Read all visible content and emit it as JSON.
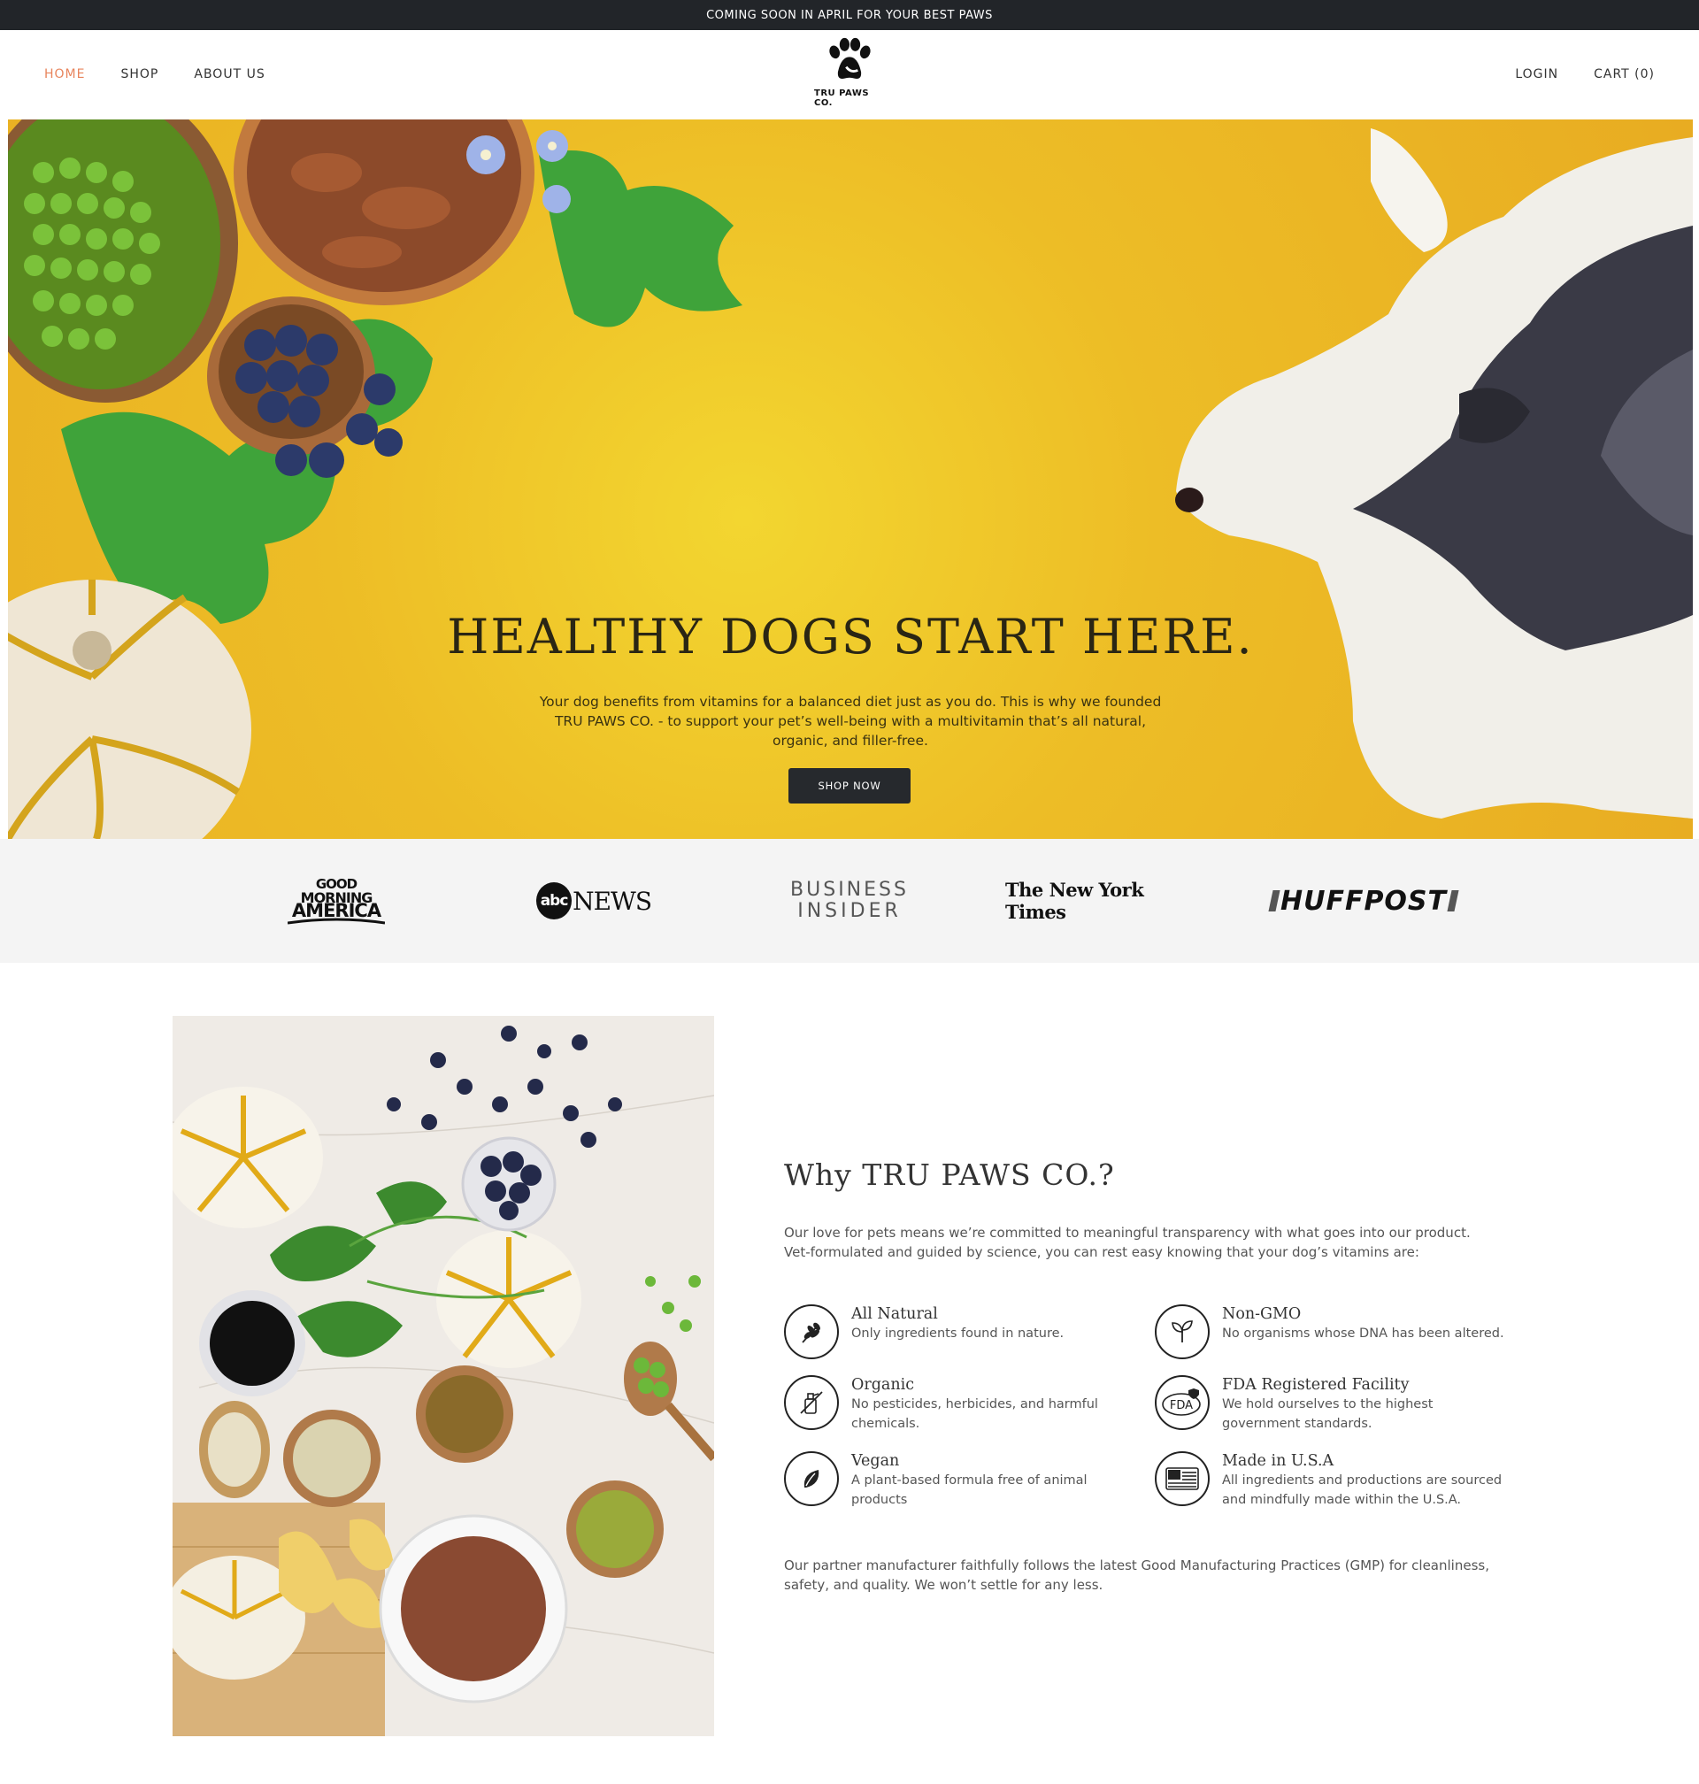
{
  "announcement": "COMING SOON IN APRIL FOR YOUR BEST PAWS",
  "nav": {
    "left": [
      "HOME",
      "SHOP",
      "ABOUT US"
    ],
    "right": [
      "LOGIN",
      "CART (0)"
    ],
    "logo_text": "TRU PAWS CO."
  },
  "hero": {
    "title": "HEALTHY DOGS START HERE.",
    "text": "Your dog benefits from vitamins for a balanced diet just as you do. This is why we founded TRU PAWS CO. - to support your pet’s well-being with a multivitamin that’s all natural, organic, and filler-free.",
    "button": "SHOP NOW"
  },
  "press": {
    "gma_line1": "GOOD",
    "gma_line2": "MORNING",
    "gma_line3": "AMERICA",
    "abc": "abc",
    "abc_news": "NEWS",
    "bi_line1": "BUSINESS",
    "bi_line2": "INSIDER",
    "nyt": "The New York Times",
    "huffpost": "HUFFPOST"
  },
  "why": {
    "title": "Why TRU PAWS CO.?",
    "intro": "Our love for pets means we’re committed to meaningful transparency with what goes into our product. Vet-formulated and guided by science, you can rest easy knowing that your dog’s vitamins are:",
    "features": [
      {
        "title": "All Natural",
        "desc": "Only ingredients found in nature.",
        "icon": "wheat-icon"
      },
      {
        "title": "Non-GMO",
        "desc": "No organisms whose DNA has been altered.",
        "icon": "sprout-icon"
      },
      {
        "title": "Organic",
        "desc": "No pesticides, herbicides, and harmful chemicals.",
        "icon": "spray-icon"
      },
      {
        "title": "FDA Registered Facility",
        "desc": "We hold ourselves to the highest government standards.",
        "icon": "fda-icon",
        "icon_text": "FDA"
      },
      {
        "title": "Vegan",
        "desc": "A plant-based formula free of animal products",
        "icon": "leaf-icon"
      },
      {
        "title": "Made in U.S.A",
        "desc": "All ingredients and productions are sourced and mindfully made within the U.S.A.",
        "icon": "flag-icon"
      }
    ],
    "outro": "Our partner manufacturer faithfully follows the latest Good Manufacturing Practices (GMP) for cleanliness, safety, and quality. We won’t settle for any less."
  },
  "colors": {
    "accent": "#e8845c",
    "hero_bg": "#edbd26",
    "dark": "#222529"
  }
}
